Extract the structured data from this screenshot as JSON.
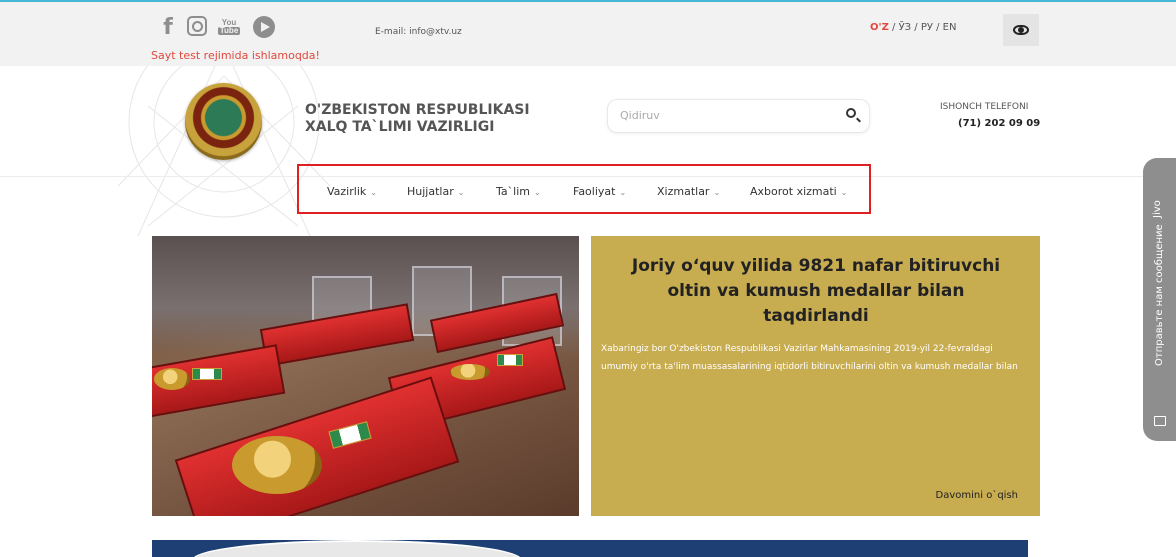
{
  "topbar": {
    "email": "E-mail: info@xtv.uz",
    "test_notice": "Sayt test rejimida ishlamoqda!",
    "languages": {
      "uz": "O'Z",
      "sep1": " / ",
      "uz_cyr": "ЎЗ",
      "sep2": " / ",
      "ru": "РУ",
      "sep3": " / ",
      "en": "EN"
    },
    "icons": [
      "facebook-icon",
      "instagram-icon",
      "youtube-icon",
      "telegram-icon",
      "eye-icon"
    ],
    "youtube_top": "You",
    "youtube_bottom": "Tube",
    "facebook_glyph": "f"
  },
  "header": {
    "ministry_line1": "O'ZBEKISTON RESPUBLIKASI",
    "ministry_line2": "XALQ TA`LIMI VAZIRLIGI",
    "search_placeholder": "Qidiruv",
    "hotline_label": "ISHONCH TELEFONI",
    "hotline_number": "(71) 202 09 09"
  },
  "nav": {
    "items": [
      {
        "label": "Vazirlik"
      },
      {
        "label": "Hujjatlar"
      },
      {
        "label": "Ta`lim"
      },
      {
        "label": "Faoliyat"
      },
      {
        "label": "Xizmatlar"
      },
      {
        "label": "Axborot xizmati"
      }
    ],
    "chevron": "⌄"
  },
  "news": {
    "title": "Joriy oʻquv yilida 9821 nafar bitiruvchi oltin va kumush medallar bilan taqdirlandi",
    "excerpt": "Xabaringiz bor O'zbekiston Respublikasi Vazirlar Mahkamasining 2019-yil 22-fevraldagi umumiy o'rta ta'lim muassasalarining iqtidorli bitiruvchilarini oltin va kumush medallar bilan",
    "read_more": "Davomini o`qish"
  },
  "feedback": {
    "label": "Отправьте нам сообщение",
    "extra": "Jivo"
  },
  "colors": {
    "accent_red": "#e2483d",
    "news_panel": "#c8ac50",
    "top_line": "#44b8d6",
    "nav_highlight": "#e02020"
  }
}
